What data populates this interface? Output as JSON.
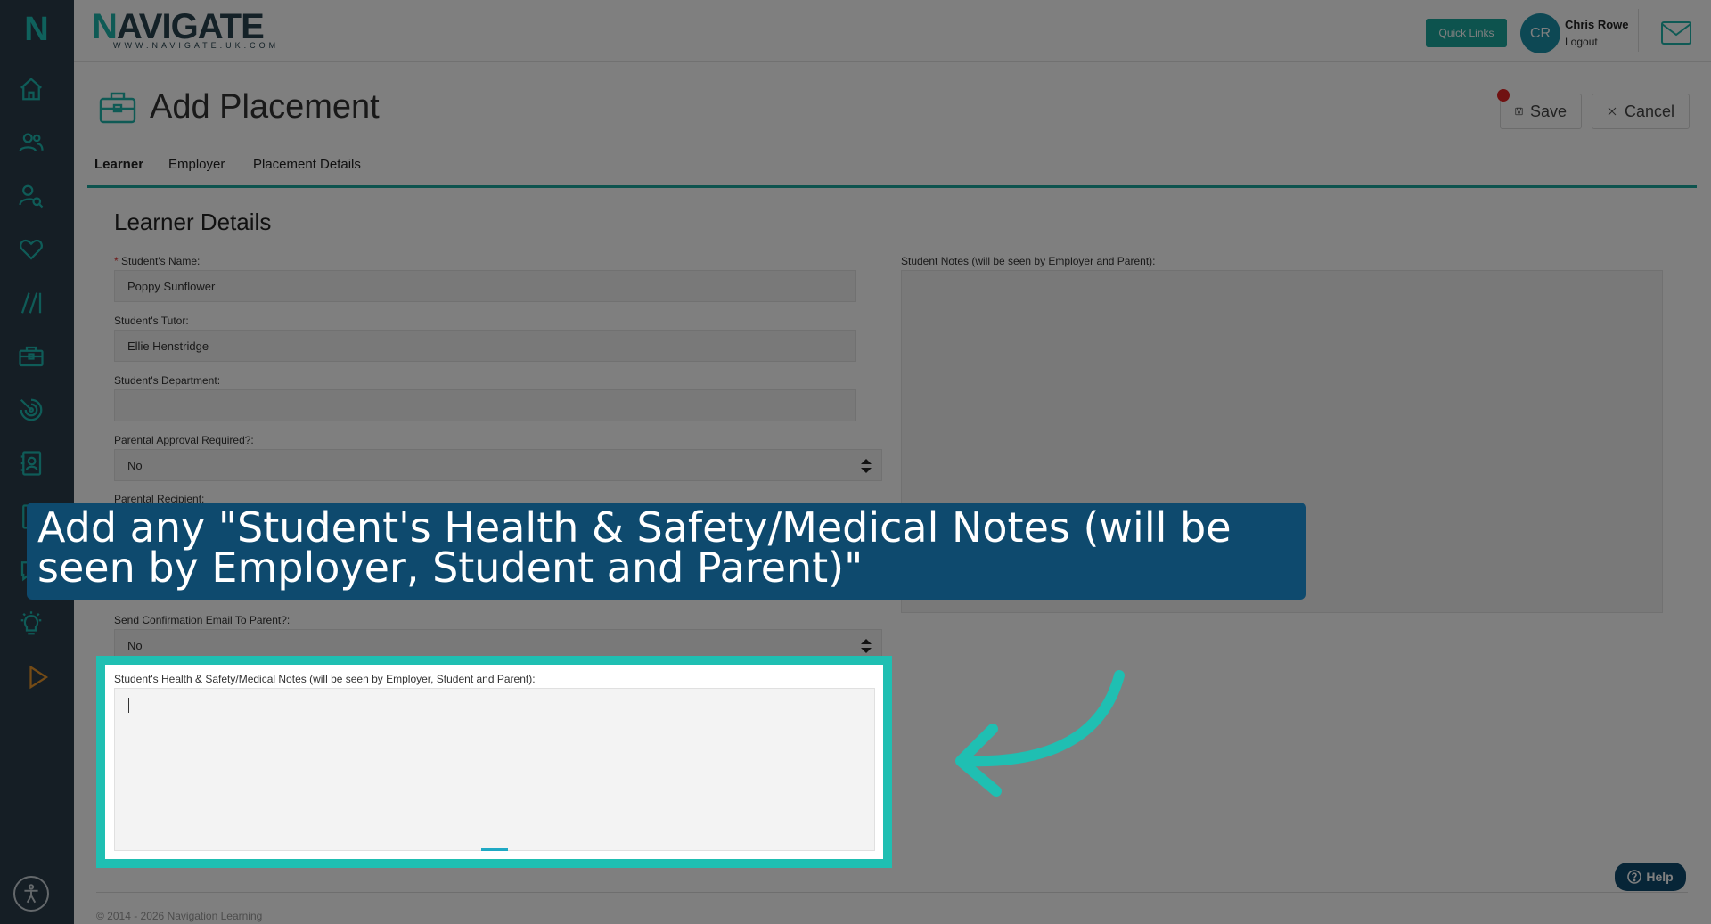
{
  "brand": {
    "name_first": "N",
    "name_rest": "AVIGATE",
    "url": "WWW.NAVIGATE.UK.COM",
    "logo_letter": "N"
  },
  "header": {
    "quick_links": "Quick Links",
    "avatar_initials": "CR",
    "user_name": "Chris Rowe",
    "logout": "Logout"
  },
  "sidebar": {
    "icons": [
      "home-icon",
      "users-icon",
      "user-search-icon",
      "heart-icon",
      "slashes-icon",
      "briefcase-icon",
      "target-icon",
      "contact-card-icon",
      "document-icon",
      "chat-icon",
      "lightbulb-icon",
      "play-icon"
    ],
    "accent": "#1eb9b0",
    "play_accent": "#e8962c"
  },
  "page": {
    "title": "Add Placement",
    "save": "Save",
    "cancel": "Cancel"
  },
  "tabs": [
    {
      "label": "Learner",
      "active": true
    },
    {
      "label": "Employer",
      "active": false
    },
    {
      "label": "Placement Details",
      "active": false
    }
  ],
  "form": {
    "section_title": "Learner Details",
    "required_mark": "*",
    "student_name_label": "Student's Name:",
    "student_name_value": "Poppy Sunflower",
    "tutor_label": "Student's Tutor:",
    "tutor_value": "Ellie Henstridge",
    "department_label": "Student's Department:",
    "department_value": "",
    "parental_approval_label": "Parental Approval Required?:",
    "parental_approval_value": "No",
    "parental_recipient_label": "Parental Recipient:",
    "confirm_email_label": "Send Confirmation Email To Parent?:",
    "confirm_email_value": "No",
    "student_notes_label": "Student Notes (will be seen by Employer and Parent):",
    "health_notes_label": "Student's Health & Safety/Medical Notes (will be seen by Employer, Student and Parent):"
  },
  "callout": {
    "text": "Add any \"Student's Health & Safety/Medical Notes (will be seen by Employer, Student and Parent)\""
  },
  "help": {
    "label": "Help"
  },
  "footer": {
    "text": "© 2014 - 2026 Navigation Learning"
  },
  "colors": {
    "brand_teal": "#1fb5aa",
    "banner": "#0e4a6e",
    "highlight": "#1fbfb2",
    "sidebar": "#2a3d4b"
  }
}
